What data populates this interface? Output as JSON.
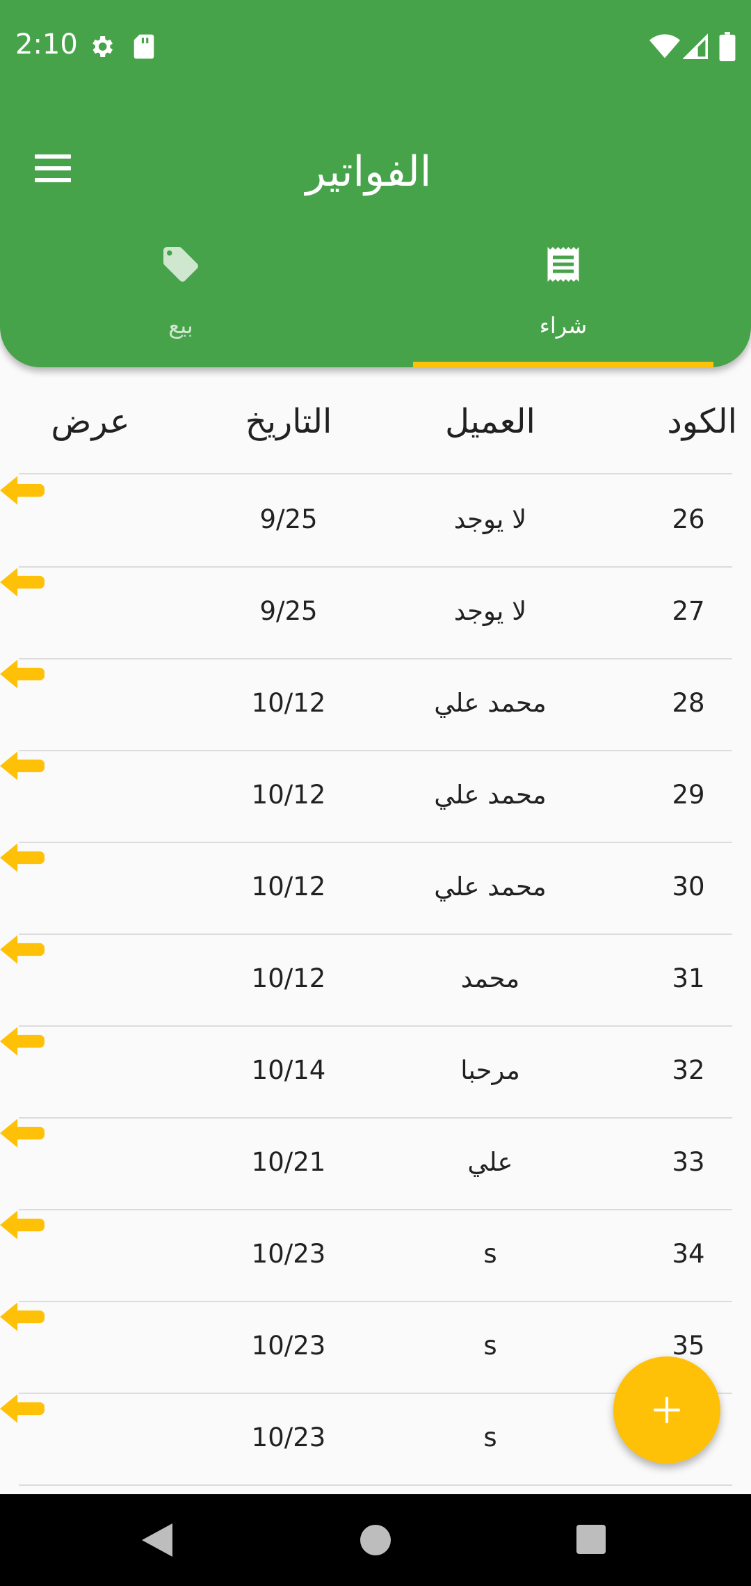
{
  "status_bar": {
    "time": "2:10",
    "icons": [
      "gear-icon",
      "sd-card-icon",
      "wifi-icon",
      "signal-icon",
      "battery-icon"
    ]
  },
  "header": {
    "title": "الفواتير",
    "menu_icon": "menu-icon",
    "tabs": [
      {
        "label": "شراء",
        "icon": "receipt-icon",
        "selected": true
      },
      {
        "label": "بيع",
        "icon": "tag-icon",
        "selected": false
      }
    ]
  },
  "table": {
    "columns": {
      "code": "الكود",
      "client": "العميل",
      "date": "التاريخ",
      "view": "عرض"
    },
    "rows": [
      {
        "code": "26",
        "client": "لا يوجد",
        "date": "9/25"
      },
      {
        "code": "27",
        "client": "لا يوجد",
        "date": "9/25"
      },
      {
        "code": "28",
        "client": "محمد علي",
        "date": "10/12"
      },
      {
        "code": "29",
        "client": "محمد علي",
        "date": "10/12"
      },
      {
        "code": "30",
        "client": "محمد علي",
        "date": "10/12"
      },
      {
        "code": "31",
        "client": "محمد",
        "date": "10/12"
      },
      {
        "code": "32",
        "client": "مرحبا",
        "date": "10/14"
      },
      {
        "code": "33",
        "client": "علي",
        "date": "10/21"
      },
      {
        "code": "34",
        "client": "s",
        "date": "10/23"
      },
      {
        "code": "35",
        "client": "s",
        "date": "10/23"
      },
      {
        "code": "",
        "client": "s",
        "date": "10/23"
      }
    ],
    "view_icon": "arrow-left-icon"
  },
  "fab": {
    "icon": "plus-icon"
  },
  "nav_bar": {
    "icons": [
      "back-icon",
      "home-icon",
      "recents-icon"
    ]
  },
  "colors": {
    "primary": "#47a34a",
    "accent": "#ffc107",
    "background": "#fafafa",
    "text": "#212121",
    "divider": "#dcdcdc"
  }
}
